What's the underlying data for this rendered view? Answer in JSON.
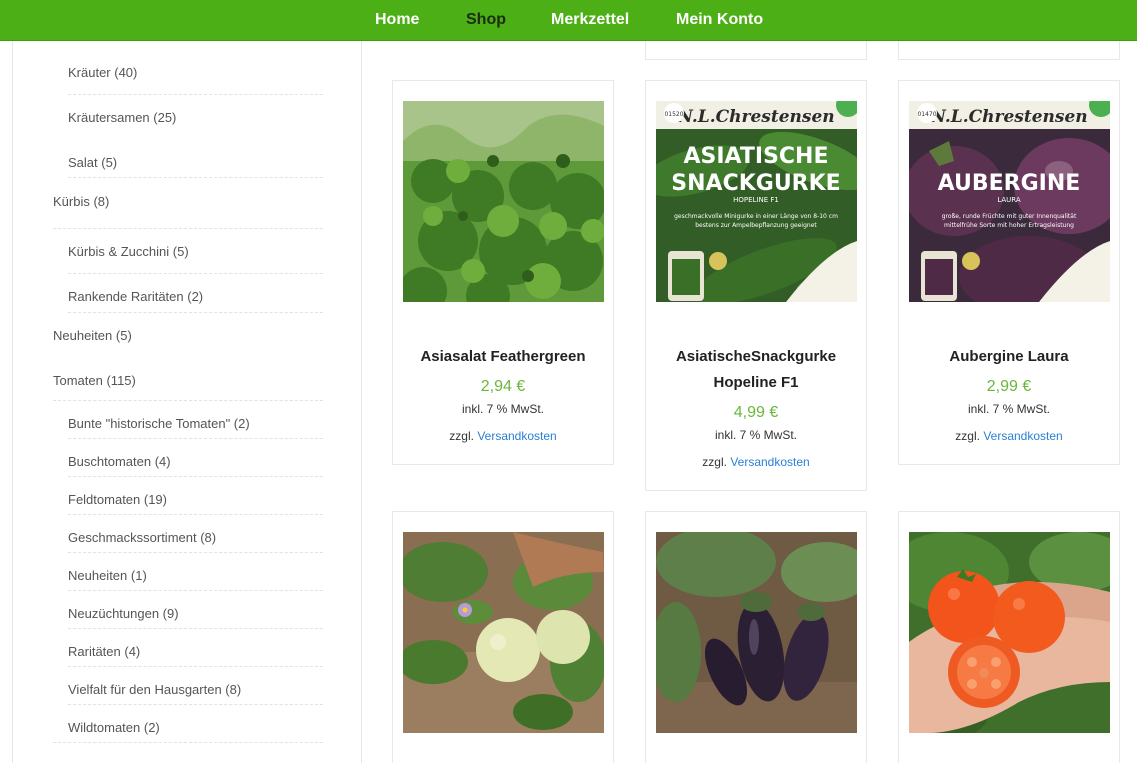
{
  "nav": {
    "items": [
      {
        "label": "Home",
        "active": false
      },
      {
        "label": "Shop",
        "active": true
      },
      {
        "label": "Merkzettel",
        "active": false
      },
      {
        "label": "Mein Konto",
        "active": false
      }
    ]
  },
  "sidebar": {
    "categories": [
      {
        "label": "Kräuter (40)",
        "level": "sub"
      },
      {
        "label": "Kräutersamen (25)",
        "level": "sub"
      },
      {
        "label": "Salat (5)",
        "level": "sub"
      },
      {
        "label": "Kürbis (8)",
        "level": "top"
      },
      {
        "label": "Kürbis & Zucchini (5)",
        "level": "sub"
      },
      {
        "label": "Rankende Raritäten (2)",
        "level": "sub"
      },
      {
        "label": "Neuheiten (5)",
        "level": "top"
      },
      {
        "label": "Tomaten (115)",
        "level": "top"
      },
      {
        "label": "Bunte \"historische Tomaten\" (2)",
        "level": "sub"
      },
      {
        "label": "Buschtomaten (4)",
        "level": "sub"
      },
      {
        "label": "Feldtomaten (19)",
        "level": "sub"
      },
      {
        "label": "Geschmackssortiment (8)",
        "level": "sub"
      },
      {
        "label": "Neuheiten (1)",
        "level": "sub"
      },
      {
        "label": "Neuzüchtungen (9)",
        "level": "sub"
      },
      {
        "label": "Raritäten (4)",
        "level": "sub"
      },
      {
        "label": "Vielfalt für den Hausgarten (8)",
        "level": "sub"
      },
      {
        "label": "Wildtomaten (2)",
        "level": "sub"
      }
    ]
  },
  "products": [
    {
      "title_lines": [
        "Asiasalat Feathergreen"
      ],
      "price": "2,94 €",
      "tax": "inkl. 7 % MwSt.",
      "shipping_prefix": "zzgl.",
      "shipping_link": "Versandkosten"
    },
    {
      "title_lines": [
        "AsiatischeSnackgurke",
        "Hopeline F1"
      ],
      "price": "4,99 €",
      "tax": "inkl. 7 % MwSt.",
      "shipping_prefix": "zzgl.",
      "shipping_link": "Versandkosten",
      "packet": {
        "brand": "N.L.Chrestensen",
        "number": "01520",
        "name_lines": [
          "ASIATISCHE",
          "SNACKGURKE"
        ],
        "variety": "HOPELINE F1",
        "desc_lines": [
          "geschmackvolle Minigurke in einer Länge von 8-10 cm",
          "bestens zur Ampelbepflanzung geeignet"
        ]
      }
    },
    {
      "title_lines": [
        "Aubergine Laura"
      ],
      "price": "2,99 €",
      "tax": "inkl. 7 % MwSt.",
      "shipping_prefix": "zzgl.",
      "shipping_link": "Versandkosten",
      "packet": {
        "brand": "N.L.Chrestensen",
        "number": "01470",
        "name_lines": [
          "AUBERGINE"
        ],
        "variety": "LAURA",
        "desc_lines": [
          "große, runde Früchte mit guter Innenqualität",
          "mittelfrühe Sorte mit hoher Ertragsleistung"
        ]
      }
    }
  ],
  "colors": {
    "nav_bg": "#4caf16",
    "price": "#6ab63a",
    "link": "#2a7fd4"
  }
}
